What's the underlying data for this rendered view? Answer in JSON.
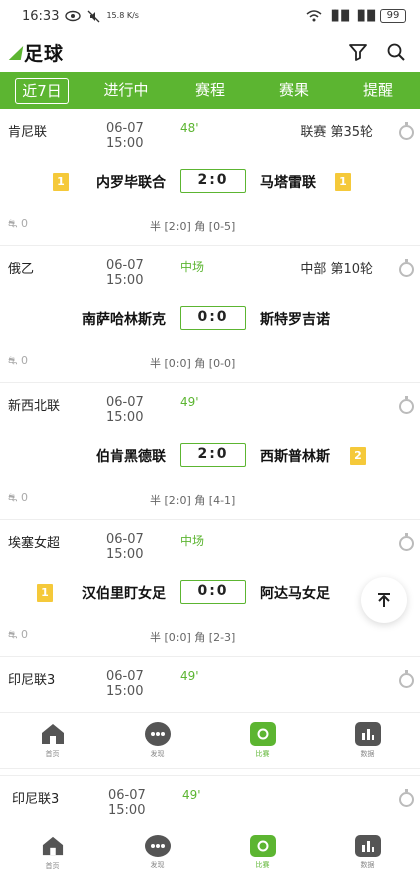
{
  "status_bar": {
    "time": "16:33",
    "speed": "15.8 K/s",
    "signal1": "▐▌█",
    "signal2": "▐▌█",
    "battery": "99"
  },
  "header": {
    "title": "足球"
  },
  "tabs": [
    {
      "label": "近7日"
    },
    {
      "label": "进行中"
    },
    {
      "label": "赛程"
    },
    {
      "label": "赛果"
    },
    {
      "label": "提醒"
    }
  ],
  "matches": [
    {
      "league": "肯尼联",
      "date": "06-07",
      "time": "15:00",
      "status": "48'",
      "round": "联赛 第35轮",
      "home": "内罗毕联合",
      "score": "2:0",
      "away": "马塔雷联",
      "home_card": "1",
      "away_card": "1",
      "fans": "0",
      "half": "半 [2:0]  角 [0-5]"
    },
    {
      "league": "俄乙",
      "date": "06-07",
      "time": "15:00",
      "status": "中场",
      "round": "中部 第10轮",
      "home": "南萨哈林斯克",
      "score": "0:0",
      "away": "斯特罗吉诺",
      "home_card": "",
      "away_card": "",
      "fans": "0",
      "half": "半 [0:0]  角 [0-0]"
    },
    {
      "league": "新西北联",
      "date": "06-07",
      "time": "15:00",
      "status": "49'",
      "round": "",
      "home": "伯肯黑德联",
      "score": "2:0",
      "away": "西斯普林斯",
      "home_card": "",
      "away_card": "2",
      "fans": "0",
      "half": "半 [2:0]  角 [4-1]"
    },
    {
      "league": "埃塞女超",
      "date": "06-07",
      "time": "15:00",
      "status": "中场",
      "round": "",
      "home": "汉伯里盯女足",
      "score": "0:0",
      "away": "阿达马女足",
      "home_card": "1",
      "away_card": "",
      "fans": "0",
      "half": "半 [0:0]  角 [2-3]"
    },
    {
      "league": "印尼联3",
      "date": "06-07",
      "time": "15:00",
      "status": "49'",
      "round": ""
    }
  ],
  "partial_match": {
    "league": "印尼联3",
    "date": "06-07",
    "time": "15:00",
    "status": "49'"
  },
  "nav": [
    {
      "label": "首页",
      "icon": "home-icon"
    },
    {
      "label": "发现",
      "icon": "chat-icon"
    },
    {
      "label": "比赛",
      "icon": "match-icon"
    },
    {
      "label": "数据",
      "icon": "chart-icon"
    }
  ],
  "colors": {
    "accent": "#5cb531",
    "card": "#f5c93a"
  }
}
